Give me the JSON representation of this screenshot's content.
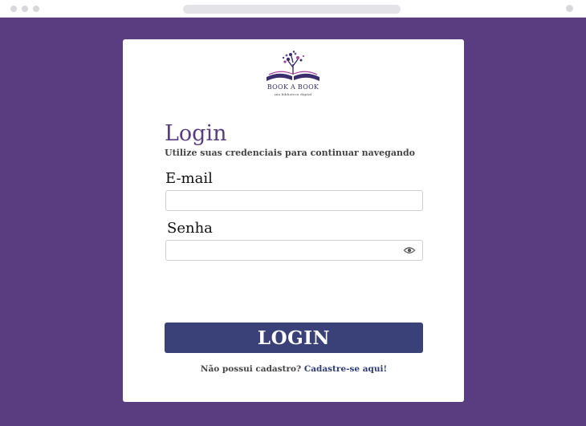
{
  "browser": {
    "window_controls": [
      "close-dot",
      "minimize-dot",
      "maximize-dot"
    ]
  },
  "brand": {
    "name": "BOOK A BOOK",
    "tagline": "sua biblioteca digital"
  },
  "login": {
    "title": "Login",
    "subtitle": "Utilize suas credenciais para continuar navegando",
    "email_label": "E-mail",
    "email_value": "",
    "email_placeholder": "",
    "password_label": "Senha",
    "password_value": "",
    "password_placeholder": "",
    "password_toggle_icon": "eye-icon",
    "submit_label": "LOGIN"
  },
  "signup": {
    "prompt": "Não possui cadastro?",
    "link_label": "Cadastre-se aqui!"
  },
  "colors": {
    "background": "#5a3c80",
    "card": "#ffffff",
    "heading": "#5a3c80",
    "button": "#3a4078",
    "link": "#2d3b78"
  }
}
